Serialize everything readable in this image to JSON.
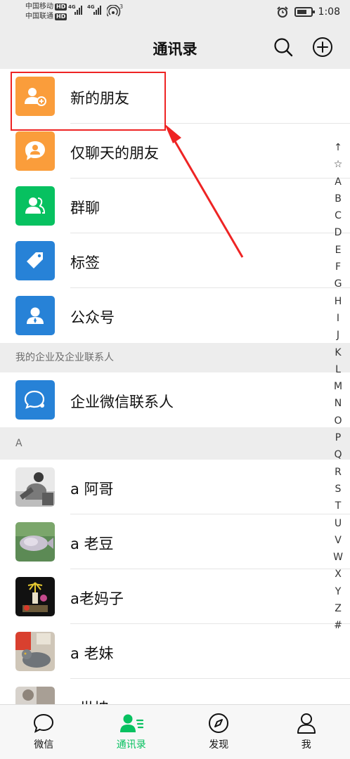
{
  "status": {
    "carrier1": "中国移动",
    "carrier2": "中国联通",
    "hd": "HD",
    "net1": "4G",
    "net2": "4G",
    "hotspot_count": "3",
    "time": "1:08"
  },
  "header": {
    "title": "通讯录"
  },
  "fixed_items": [
    {
      "label": "新的朋友",
      "color": "#fa9d3b"
    },
    {
      "label": "仅聊天的朋友",
      "color": "#fa9d3b"
    },
    {
      "label": "群聊",
      "color": "#07c160"
    },
    {
      "label": "标签",
      "color": "#2782d7"
    },
    {
      "label": "公众号",
      "color": "#2782d7"
    }
  ],
  "enterprise": {
    "section_title": "我的企业及企业联系人",
    "item_label": "企业微信联系人",
    "color": "#2782d7"
  },
  "contacts": {
    "section_title": "A",
    "items": [
      {
        "name": "a 阿哥"
      },
      {
        "name": "a 老豆"
      },
      {
        "name": "a老妈子"
      },
      {
        "name": "a 老妹"
      },
      {
        "name": "a世坤"
      }
    ]
  },
  "index_letters": [
    "↑",
    "☆",
    "A",
    "B",
    "C",
    "D",
    "E",
    "F",
    "G",
    "H",
    "I",
    "J",
    "K",
    "L",
    "M",
    "N",
    "O",
    "P",
    "Q",
    "R",
    "S",
    "T",
    "U",
    "V",
    "W",
    "X",
    "Y",
    "Z",
    "#"
  ],
  "bottom_nav": [
    {
      "label": "微信",
      "icon": "chat-bubble-icon"
    },
    {
      "label": "通讯录",
      "icon": "contacts-icon"
    },
    {
      "label": "发现",
      "icon": "compass-icon"
    },
    {
      "label": "我",
      "icon": "person-icon"
    }
  ],
  "colors": {
    "accent": "#07c160",
    "highlight": "#ee2424"
  }
}
